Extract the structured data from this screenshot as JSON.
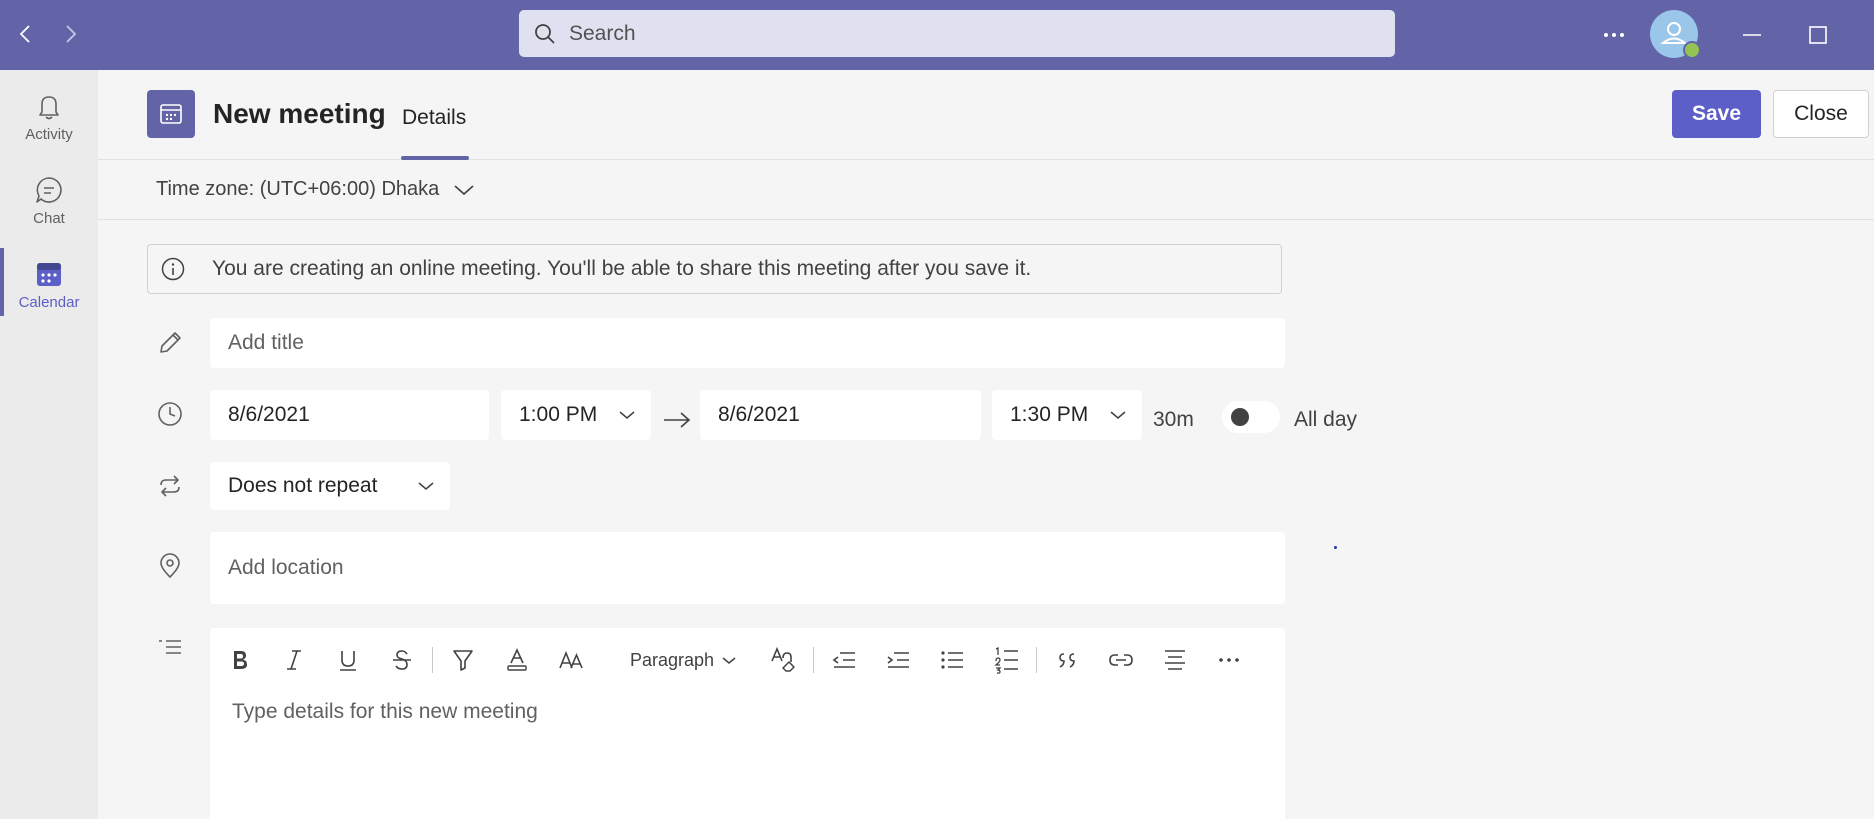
{
  "titlebar": {
    "search_placeholder": "Search",
    "icons": [
      "back-icon",
      "forward-icon",
      "search-icon",
      "more-icon",
      "avatar-icon",
      "minimize-icon",
      "maximize-icon"
    ],
    "status_color": "#92c353",
    "brand_color": "#6264a7"
  },
  "rail": {
    "items": [
      {
        "label": "Activity",
        "icon": "bell-icon"
      },
      {
        "label": "Chat",
        "icon": "chat-icon"
      },
      {
        "label": "Calendar",
        "icon": "calendar-icon",
        "active": true
      }
    ]
  },
  "header": {
    "title": "New meeting",
    "tab": "Details",
    "save_label": "Save",
    "close_label": "Close"
  },
  "timezone": {
    "label": "Time zone: (UTC+06:00) Dhaka"
  },
  "info": {
    "message": "You are creating an online meeting. You'll be able to share this meeting after you save it."
  },
  "form": {
    "title_placeholder": "Add title",
    "start_date": "8/6/2021",
    "start_time": "1:00 PM",
    "end_date": "8/6/2021",
    "end_time": "1:30 PM",
    "duration": "30m",
    "all_day_label": "All day",
    "all_day_on": false,
    "repeat": "Does not repeat",
    "location_placeholder": "Add location"
  },
  "editor": {
    "paragraph_label": "Paragraph",
    "placeholder": "Type details for this new meeting",
    "toolbar_icons": [
      "bold-icon",
      "italic-icon",
      "underline-icon",
      "strikethrough-icon",
      "highlight-icon",
      "font-color-icon",
      "font-size-icon",
      "paragraph-dropdown",
      "clear-format-icon",
      "decrease-indent-icon",
      "increase-indent-icon",
      "bullet-list-icon",
      "numbered-list-icon",
      "quote-icon",
      "link-icon",
      "align-icon",
      "more-options-icon"
    ]
  }
}
